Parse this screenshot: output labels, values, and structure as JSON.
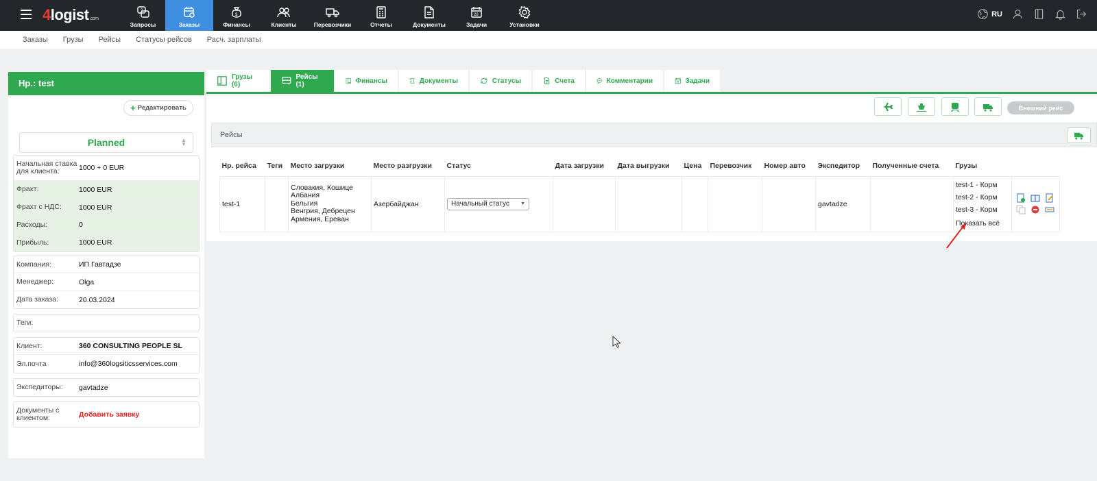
{
  "topbar": {
    "logo_num": "4",
    "logo_text": "logist",
    "logo_com": ".com",
    "nav": [
      {
        "label": "Запросы",
        "icon": "requests-icon"
      },
      {
        "label": "Заказы",
        "icon": "orders-icon"
      },
      {
        "label": "Финансы",
        "icon": "finance-icon"
      },
      {
        "label": "Клиенты",
        "icon": "clients-icon"
      },
      {
        "label": "Перевозчики",
        "icon": "carriers-icon"
      },
      {
        "label": "Отчеты",
        "icon": "reports-icon"
      },
      {
        "label": "Документы",
        "icon": "documents-icon"
      },
      {
        "label": "Задачи",
        "icon": "tasks-icon"
      },
      {
        "label": "Установки",
        "icon": "settings-icon"
      }
    ],
    "active_nav": "Заказы",
    "lang": "RU"
  },
  "subnav": [
    "Заказы",
    "Грузы",
    "Рейсы",
    "Статусы рейсов",
    "Расч. зарплаты"
  ],
  "order": {
    "title": "Нр.: test",
    "edit_label": "Редактировать",
    "status": "Planned",
    "finance": [
      {
        "key": "Начальная ставка для клиента:",
        "value": "1000 + 0 EUR"
      },
      {
        "key": "Фрахт:",
        "value": "1000 EUR"
      },
      {
        "key": "Фрахт с НДС:",
        "value": "1000 EUR"
      },
      {
        "key": "Расходы:",
        "value": "0"
      },
      {
        "key": "Прибыль:",
        "value": "1000 EUR"
      }
    ],
    "info": [
      {
        "key": "Компания:",
        "value": "ИП Гавтадзе"
      },
      {
        "key": "Менеджер:",
        "value": "Olga"
      },
      {
        "key": "Дата заказа:",
        "value": "20.03.2024"
      }
    ],
    "tags_label": "Теги:",
    "client": [
      {
        "key": "Клиент:",
        "value": "360 CONSULTING PEOPLE SL"
      },
      {
        "key": "Эл.почта",
        "value": "info@360logsiticsservices.com"
      }
    ],
    "forwarders_label": "Экспедиторы:",
    "forwarders_value": "gavtadze",
    "docs_label": "Документы с клиентом:",
    "docs_action": "Добавить заявку"
  },
  "tabs": [
    {
      "label": "Грузы (6)",
      "icon": "cargo-icon"
    },
    {
      "label": "Рейсы (1)",
      "icon": "bus-icon"
    },
    {
      "label": "Финансы",
      "icon": "finance-tab-icon"
    },
    {
      "label": "Документы",
      "icon": "document-icon"
    },
    {
      "label": "Статусы",
      "icon": "refresh-icon"
    },
    {
      "label": "Счета",
      "icon": "invoice-icon"
    },
    {
      "label": "Комментарии",
      "icon": "comment-icon"
    },
    {
      "label": "Задачи",
      "icon": "calendar-icon"
    }
  ],
  "active_tab": "Рейсы (1)",
  "toolbar": {
    "external_trip": "Внешний рейс"
  },
  "trips": {
    "section_title": "Рейсы",
    "columns": [
      "Нр. рейса",
      "Теги",
      "Место загрузки",
      "Место разгрузки",
      "Статус",
      "Дата загрузки",
      "Дата выгрузки",
      "Цена",
      "Перевозчик",
      "Номер авто",
      "Экспедитор",
      "Полученные счета",
      "Грузы"
    ],
    "row": {
      "number": "test-1",
      "tags": "",
      "loading": [
        "Словакия, Кошице",
        "Албания",
        "Бельгия",
        "Венгрия, Дебрецен",
        "Армения, Ереван"
      ],
      "unloading": "Азербайджан",
      "status": "Начальный статус",
      "load_date": "",
      "unload_date": "",
      "price": "",
      "carrier": "",
      "vehicle": "",
      "forwarder": "gavtadze",
      "invoices": "",
      "cargo": [
        "test-1 - Корм",
        "test-2 - Корм",
        "test-3 - Корм"
      ],
      "show_all": "Показать всё"
    }
  },
  "colors": {
    "green": "#2fa84f",
    "blue": "#3f8fe0",
    "dark": "#23272b",
    "red": "#e52424"
  }
}
